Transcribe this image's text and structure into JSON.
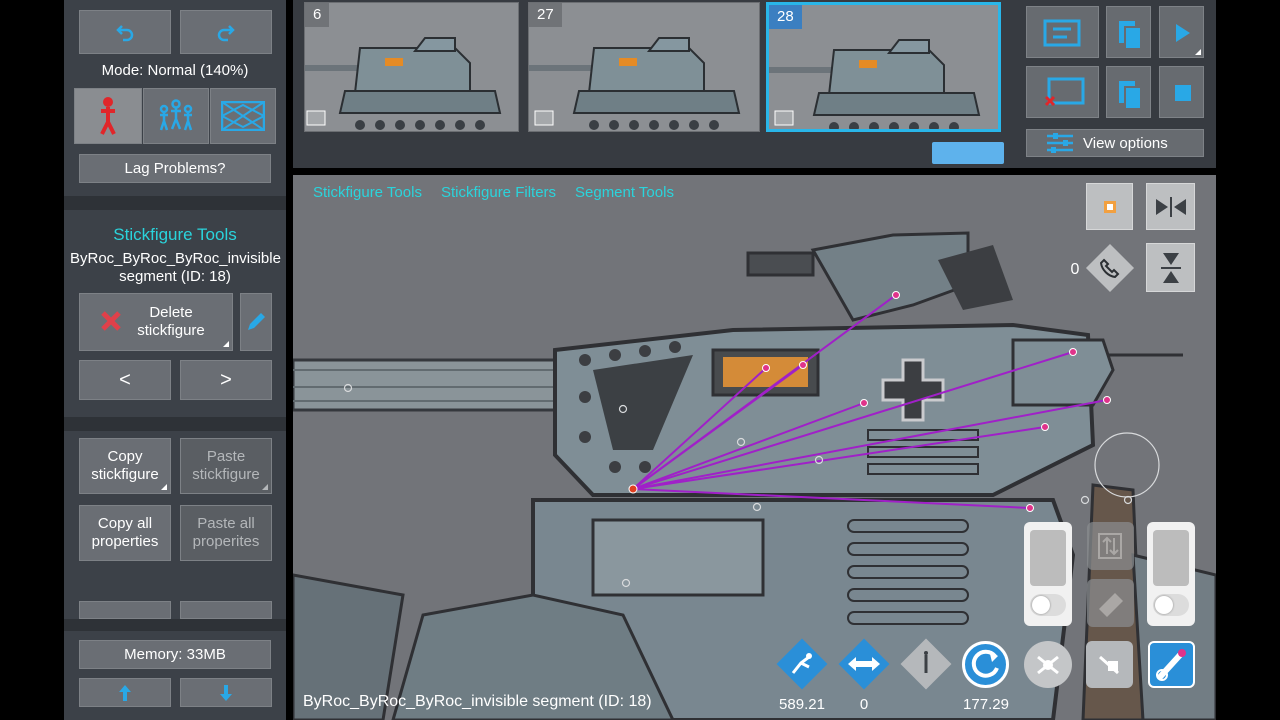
{
  "sidebar": {
    "mode_label": "Mode: Normal (140%)",
    "lag_button": "Lag Problems?",
    "section_title": "Stickfigure Tools",
    "selected_name": "ByRoc_ByRoc_ByRoc_invisible segment (ID: 18)",
    "delete_button": "Delete stickfigure",
    "prev_button": "<",
    "next_button": ">",
    "copy_stickfigure": "Copy stickfigure",
    "paste_stickfigure": "Paste stickfigure",
    "copy_properties": "Copy all properties",
    "paste_properties": "Paste all properites",
    "memory": "Memory: 33MB"
  },
  "frames": [
    {
      "number": "6"
    },
    {
      "number": "27"
    },
    {
      "number": "28",
      "selected": true
    }
  ],
  "toolbar": {
    "view_options": "View options"
  },
  "tabs": [
    "Stickfigure Tools",
    "Stickfigure Filters",
    "Segment Tools"
  ],
  "canvas": {
    "layer_count": "0"
  },
  "status": {
    "segment_label": "ByRoc_ByRoc_ByRoc_invisible segment (ID: 18)",
    "value_1": "589.21",
    "value_2": "0",
    "value_3": "177.29"
  },
  "colors": {
    "accent": "#29b6e9",
    "tab_text": "#2ad4dc",
    "joint": "#e0338a",
    "segment_line": "#a020c8"
  },
  "icons": [
    "undo-icon",
    "redo-icon",
    "stickfigure-icon",
    "group-icon",
    "image-icon",
    "delete-icon",
    "edit-icon",
    "play-icon",
    "stop-icon",
    "view-options-icon",
    "flip-horizontal-icon",
    "flip-vertical-icon",
    "up-arrow-icon",
    "down-arrow-icon"
  ]
}
